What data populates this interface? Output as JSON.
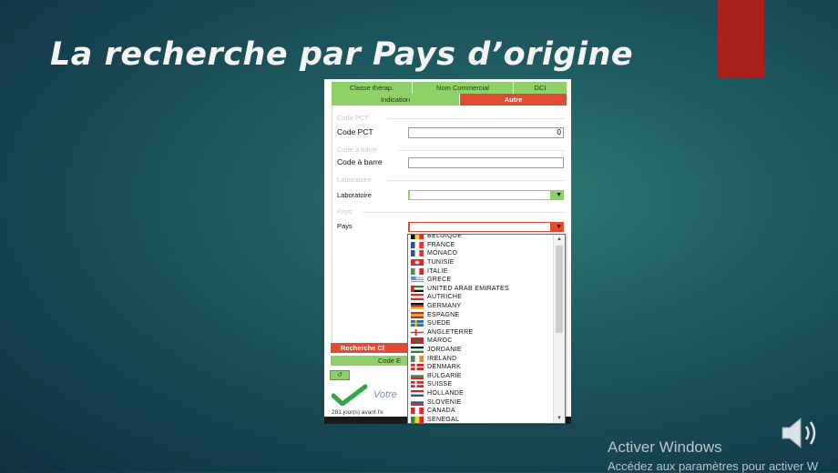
{
  "slide": {
    "title": "La recherche par Pays d’origine"
  },
  "tabs_row1": [
    "Classe thérap.",
    "Nom Commercial",
    "DCI"
  ],
  "tabs_row2": [
    "Indication",
    "Autre"
  ],
  "form": {
    "code_pct_section": "Code PCT",
    "code_pct_label": "Code PCT",
    "code_pct_value": "0",
    "code_barre_section": "Code à barre",
    "code_barre_label": "Code à barre",
    "laboratoire_section": "Laboratoire",
    "laboratoire_label": "Laboratoire",
    "pays_section": "Pays",
    "pays_label": "Pays"
  },
  "buttons": {
    "recherche": "Recherche Cl",
    "code": "Code E"
  },
  "status": {
    "votre": "Votre",
    "days_text": "281 jour(s) avant l'e"
  },
  "countries": [
    {
      "name": "BELGIQUE",
      "flag": [
        "v",
        "#111111",
        "#f3d03a",
        "#e02a2a"
      ]
    },
    {
      "name": "FRANCE",
      "flag": [
        "v",
        "#2c4fa8",
        "#ffffff",
        "#e0333a"
      ]
    },
    {
      "name": "MONACO",
      "flag": [
        "v",
        "#2c4fa8",
        "#ffffff",
        "#e0333a"
      ]
    },
    {
      "name": "TUNISIE",
      "flag": [
        "c",
        "#e3262b",
        "#ffffff"
      ]
    },
    {
      "name": "ITALIE",
      "flag": [
        "v",
        "#2e9a45",
        "#ffffff",
        "#d92b2b"
      ]
    },
    {
      "name": "GRECE",
      "flag": [
        "s",
        "#5a8fd6",
        "#ffffff"
      ]
    },
    {
      "name": "UNITED ARAB EMIRATES",
      "flag": [
        "u",
        "#c8262a",
        "#1e8a3d",
        "#ffffff",
        "#111111"
      ]
    },
    {
      "name": "AUTRICHE",
      "flag": [
        "h",
        "#d82a2a",
        "#ffffff",
        "#d82a2a"
      ]
    },
    {
      "name": "GERMANY",
      "flag": [
        "h",
        "#111111",
        "#d8262a",
        "#f2c20f"
      ]
    },
    {
      "name": "ESPAGNE",
      "flag": [
        "h",
        "#c82a2a",
        "#f3c20d",
        "#c82a2a"
      ]
    },
    {
      "name": "SUEDE",
      "flag": [
        "x",
        "#2b6cb2",
        "#f6cd1c"
      ]
    },
    {
      "name": "ANGLETERRE",
      "flag": [
        "x",
        "#ffffff",
        "#d9262a"
      ]
    },
    {
      "name": "MAROC",
      "flag": [
        "c",
        "#c6262b",
        "#2a7a3b"
      ]
    },
    {
      "name": "JORDANIE",
      "flag": [
        "h",
        "#111111",
        "#ffffff",
        "#2a8a3b"
      ]
    },
    {
      "name": "IRELAND",
      "flag": [
        "v",
        "#2a9a4a",
        "#ffffff",
        "#f08a22"
      ]
    },
    {
      "name": "DENMARK",
      "flag": [
        "x",
        "#c8262b",
        "#ffffff"
      ]
    },
    {
      "name": "BULGARIE",
      "flag": [
        "h",
        "#ffffff",
        "#2a8a4a",
        "#d8262a"
      ]
    },
    {
      "name": "SUISSE",
      "flag": [
        "x",
        "#d9262a",
        "#ffffff"
      ]
    },
    {
      "name": "HOLLANDE",
      "flag": [
        "h",
        "#c0262a",
        "#ffffff",
        "#2a4fa0"
      ]
    },
    {
      "name": "SLOVENIE",
      "flag": [
        "h",
        "#ffffff",
        "#2a4fa8",
        "#d9262a"
      ]
    },
    {
      "name": "CANADA",
      "flag": [
        "v",
        "#d9262a",
        "#ffffff",
        "#d9262a"
      ]
    },
    {
      "name": "SENEGAL",
      "flag": [
        "v",
        "#2a8a3b",
        "#f2d21a",
        "#d9262a"
      ]
    }
  ],
  "watermark": {
    "line1": "Activer Windows",
    "line2": "Accédez aux paramètres pour activer W"
  },
  "colors": {
    "green_tab": "#8fd168",
    "red_tab": "#e04b33",
    "accent_block": "#a8201b"
  }
}
